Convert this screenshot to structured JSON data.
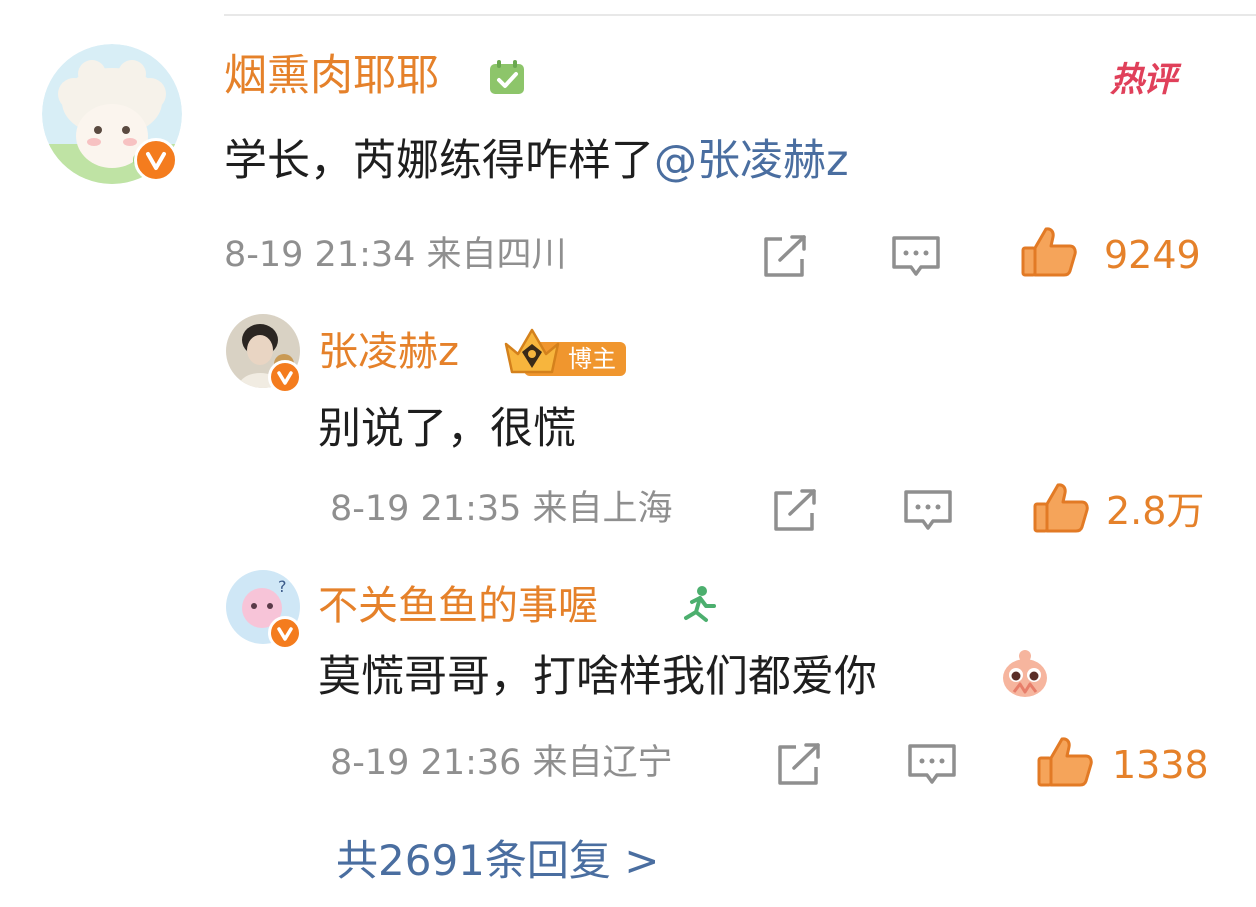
{
  "colors": {
    "username": "#e5812a",
    "mention": "#4a6ea0",
    "meta": "#8f8f8f",
    "like": "#e5812a",
    "hot": "#e0405a",
    "verified": "#f47c1e"
  },
  "main_comment": {
    "username": "烟熏肉耶耶",
    "hot_label": "热评",
    "text": "学长，芮娜练得咋样了",
    "mention": "@张凌赫z",
    "time_location": "8-19 21:34 来自四川",
    "likes": "9249",
    "icons": [
      "share-icon",
      "comment-icon",
      "like-icon"
    ]
  },
  "replies": [
    {
      "username": "张凌赫z",
      "badge": "博主",
      "text": "别说了，很慌",
      "time_location": "8-19 21:35 来自上海",
      "likes": "2.8万"
    },
    {
      "username": "不关鱼鱼的事喔",
      "text": "莫慌哥哥，打啥样我们都爱你",
      "emoji": "pleading-emoji",
      "time_location": "8-19 21:36 来自辽宁",
      "likes": "1338"
    }
  ],
  "more_replies": "共2691条回复 >"
}
